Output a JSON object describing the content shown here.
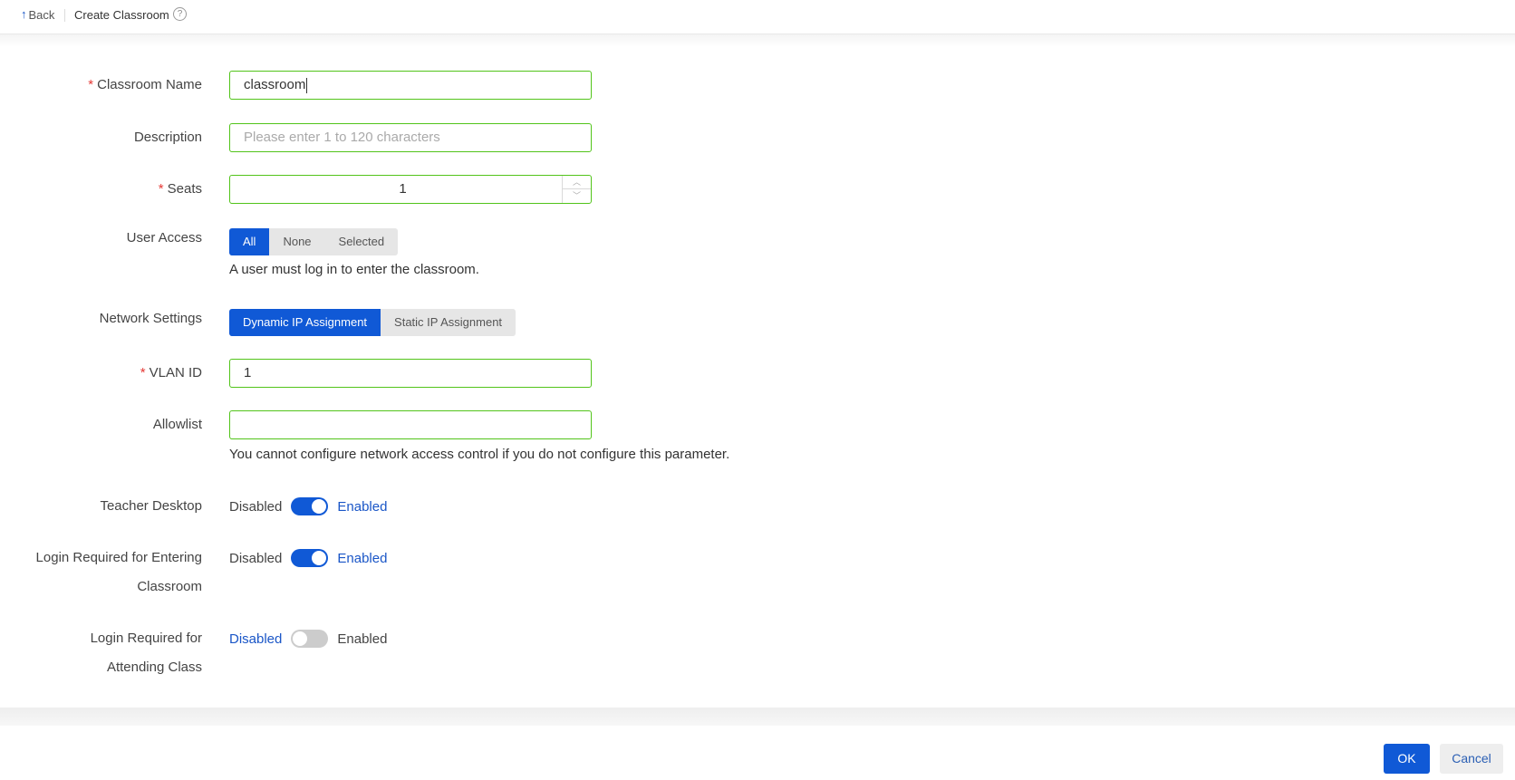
{
  "header": {
    "back_label": "Back",
    "page_title": "Create Classroom",
    "help_glyph": "?"
  },
  "form": {
    "classroom_name": {
      "label": "Classroom Name",
      "required": "*",
      "value": "classroom"
    },
    "description": {
      "label": "Description",
      "value": "",
      "placeholder": "Please enter 1 to 120 characters"
    },
    "seats": {
      "label": "Seats",
      "required": "*",
      "value": "1"
    },
    "user_access": {
      "label": "User Access",
      "options": [
        "All",
        "None",
        "Selected"
      ],
      "selected": "All",
      "hint": "A user must log in to enter the classroom."
    },
    "network_settings": {
      "label": "Network Settings",
      "options": [
        "Dynamic IP Assignment",
        "Static IP Assignment"
      ],
      "selected": "Dynamic IP Assignment"
    },
    "vlan_id": {
      "label": "VLAN ID",
      "required": "*",
      "value": "1"
    },
    "allowlist": {
      "label": "Allowlist",
      "value": "",
      "hint": "You cannot configure network access control if you do not configure this parameter."
    },
    "teacher_desktop": {
      "label": "Teacher Desktop",
      "off_label": "Disabled",
      "on_label": "Enabled",
      "enabled": true
    },
    "login_entering": {
      "label_line1": "Login Required for Entering",
      "label_line2": "Classroom",
      "off_label": "Disabled",
      "on_label": "Enabled",
      "enabled": true
    },
    "login_attending": {
      "label_line1": "Login Required for",
      "label_line2": "Attending Class",
      "off_label": "Disabled",
      "on_label": "Enabled",
      "enabled": false
    }
  },
  "footer": {
    "ok_label": "OK",
    "cancel_label": "Cancel"
  },
  "colors": {
    "primary": "#1059d6",
    "valid_border": "#52c41a",
    "required": "#e53935",
    "link": "#1a56c7"
  }
}
